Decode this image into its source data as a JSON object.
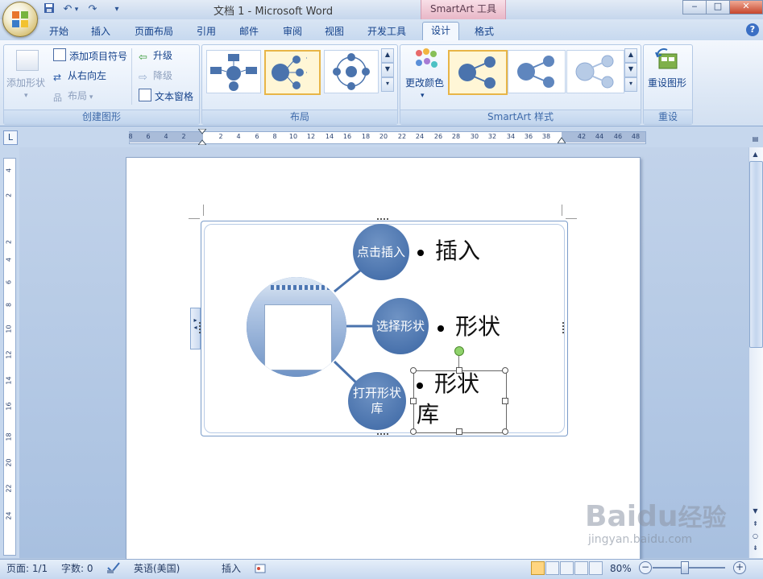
{
  "titlebar": {
    "title": "文档 1 - Microsoft Word",
    "contextual_tab": "SmartArt 工具",
    "qat_menu_glyph": "▾"
  },
  "tabs": [
    {
      "label": "开始"
    },
    {
      "label": "插入"
    },
    {
      "label": "页面布局"
    },
    {
      "label": "引用"
    },
    {
      "label": "邮件"
    },
    {
      "label": "审阅"
    },
    {
      "label": "视图"
    },
    {
      "label": "开发工具"
    },
    {
      "label": "设计",
      "active": true
    },
    {
      "label": "格式"
    }
  ],
  "ribbon": {
    "create_group": {
      "label": "创建图形",
      "add_shape": "添加形状",
      "add_bullet": "添加项目符号",
      "right_to_left": "从右向左",
      "layout": "布局",
      "promote": "升级",
      "demote": "降级",
      "text_pane": "文本窗格"
    },
    "layout_group": {
      "label": "布局"
    },
    "styles_group": {
      "label": "SmartArt 样式",
      "change_colors": "更改颜色"
    },
    "reset_group": {
      "label": "重设",
      "reset_graphic": "重设图形"
    }
  },
  "ruler": {
    "h_ticks": [
      "8",
      "6",
      "4",
      "2",
      "2",
      "4",
      "6",
      "8",
      "10",
      "12",
      "14",
      "16",
      "18",
      "20",
      "22",
      "24",
      "26",
      "28",
      "30",
      "32",
      "34",
      "36",
      "38",
      "42",
      "44",
      "46",
      "48"
    ],
    "v_ticks": [
      "4",
      "2",
      "2",
      "4",
      "6",
      "8",
      "10",
      "12",
      "14",
      "16",
      "18",
      "20",
      "22",
      "24"
    ]
  },
  "smartart": {
    "nodes": [
      {
        "circle": "点击插入",
        "text": "插入"
      },
      {
        "circle": "选择形状",
        "text": "形状"
      },
      {
        "circle": "打开形状库",
        "text": "形状库"
      }
    ]
  },
  "statusbar": {
    "page": "页面: 1/1",
    "words": "字数: 0",
    "language": "英语(美国)",
    "mode": "插入",
    "zoom": "80%"
  },
  "watermark": {
    "brand": "Baidu",
    "brand_cn": "经验",
    "url": "jingyan.baidu.com"
  },
  "colors": {
    "accent_blue": "#4a73ad",
    "ribbon_text": "#15428b",
    "tab_context": "#e8b7c7"
  }
}
